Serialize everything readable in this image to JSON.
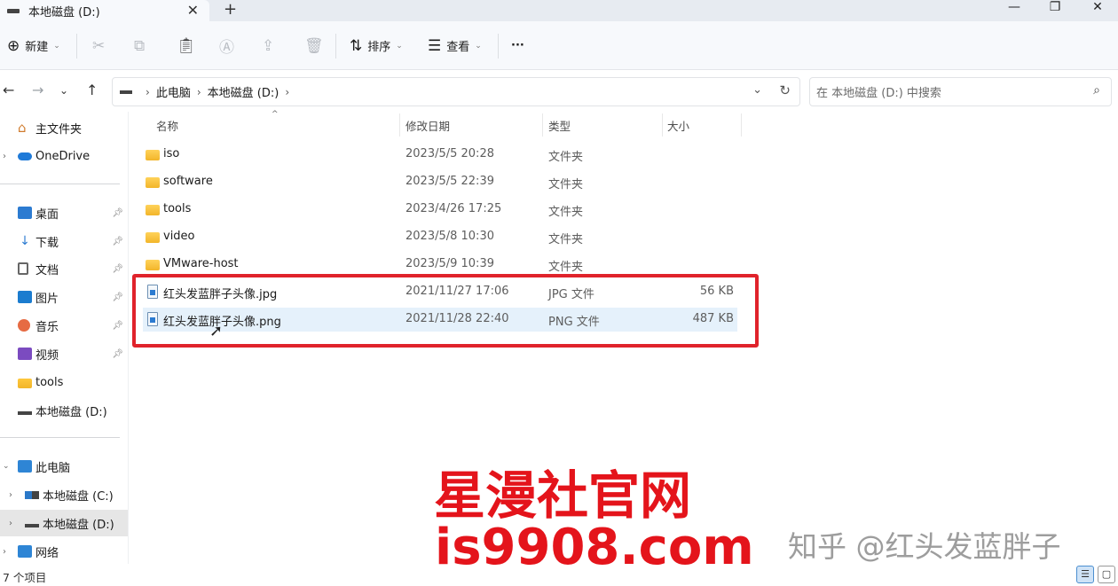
{
  "tab": {
    "title": "本地磁盘 (D:)",
    "close": "✕",
    "new": "+"
  },
  "window_controls": {
    "minimize": "—",
    "maximize": "❐",
    "close": "✕"
  },
  "toolbar": {
    "new_label": "新建",
    "sort_label": "排序",
    "view_label": "查看",
    "more_label": "···"
  },
  "address": {
    "crumbs": [
      "此电脑",
      "本地磁盘 (D:)"
    ],
    "search_placeholder": "在 本地磁盘 (D:) 中搜索"
  },
  "sidebar": {
    "top": [
      {
        "label": "主文件夹"
      },
      {
        "label": "OneDrive"
      }
    ],
    "quick": [
      {
        "label": "桌面"
      },
      {
        "label": "下载"
      },
      {
        "label": "文档"
      },
      {
        "label": "图片"
      },
      {
        "label": "音乐"
      },
      {
        "label": "视频"
      },
      {
        "label": "tools"
      },
      {
        "label": "本地磁盘 (D:)"
      }
    ],
    "tree": [
      {
        "label": "此电脑"
      },
      {
        "label": "本地磁盘 (C:)"
      },
      {
        "label": "本地磁盘 (D:)"
      },
      {
        "label": "网络"
      }
    ]
  },
  "columns": {
    "name": "名称",
    "date": "修改日期",
    "type": "类型",
    "size": "大小"
  },
  "files": [
    {
      "name": "iso",
      "date": "2023/5/5 20:28",
      "type": "文件夹",
      "size": "",
      "kind": "folder"
    },
    {
      "name": "software",
      "date": "2023/5/5 22:39",
      "type": "文件夹",
      "size": "",
      "kind": "folder"
    },
    {
      "name": "tools",
      "date": "2023/4/26 17:25",
      "type": "文件夹",
      "size": "",
      "kind": "folder"
    },
    {
      "name": "video",
      "date": "2023/5/8 10:30",
      "type": "文件夹",
      "size": "",
      "kind": "folder"
    },
    {
      "name": "VMware-host",
      "date": "2023/5/9 10:39",
      "type": "文件夹",
      "size": "",
      "kind": "folder"
    },
    {
      "name": "红头发蓝胖子头像.jpg",
      "date": "2021/11/27 17:06",
      "type": "JPG 文件",
      "size": "56 KB",
      "kind": "image"
    },
    {
      "name": "红头发蓝胖子头像.png",
      "date": "2021/11/28 22:40",
      "type": "PNG 文件",
      "size": "487 KB",
      "kind": "image"
    }
  ],
  "status": {
    "count": "7 个项目"
  },
  "watermark": {
    "title": "星漫社官网",
    "url": "is9908.com",
    "zhihu": "知乎 @红头发蓝胖子"
  },
  "colors": {
    "accent": "#0067c0",
    "highlight_box": "#e0232b",
    "watermark": "#e4141b"
  }
}
